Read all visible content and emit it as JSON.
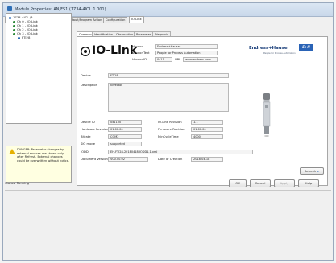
{
  "window": {
    "title": "Module Properties: AN/FS1 (1734-4IOL 1.001)"
  },
  "tabs": [
    {
      "label": "General",
      "active": false
    },
    {
      "label": "Connection",
      "active": false
    },
    {
      "label": "Module Info",
      "active": false
    },
    {
      "label": "Fault/Program Action",
      "active": false
    },
    {
      "label": "Configuration",
      "active": false
    },
    {
      "label": "IO-Link",
      "active": true
    }
  ],
  "tree": {
    "items": [
      {
        "label": "1734-4IOL /A",
        "level": 0
      },
      {
        "label": "Ch 0 - IO-Link",
        "level": 1
      },
      {
        "label": "Ch 1 - IO-Link",
        "level": 1
      },
      {
        "label": "Ch 2 - IO-Link",
        "level": 1
      },
      {
        "label": "Ch 3 - IO-Link",
        "level": 1
      },
      {
        "label": "FTI28",
        "level": 2
      }
    ]
  },
  "warning": {
    "text": "DANGER: Parameter changes by external sources are shown only after Refresh. External changes could be overwritten without notice."
  },
  "subtabs": [
    {
      "label": "Common",
      "active": true
    },
    {
      "label": "Identification",
      "active": false
    },
    {
      "label": "Observation",
      "active": false
    },
    {
      "label": "Parameter",
      "active": false
    },
    {
      "label": "Diagnosis",
      "active": false
    }
  ],
  "brand": {
    "iolink_text": "IO-Link",
    "vendor_logo_text": "Endress+Hauser",
    "vendor_logo_badge": "E+H",
    "vendor_tagline": "People for Process Automation",
    "accent": "#2a63b6"
  },
  "vendor": {
    "vendor_label": "Vendor",
    "vendor_value": "Endress+Hauser",
    "vendor_text_label": "Vendor Text",
    "vendor_text_value": "People for Process Automation",
    "vendor_id_label": "Vendor ID",
    "vendor_id_value": "0x11",
    "url_label": "URL",
    "url_value": "www.endress.com"
  },
  "device": {
    "device_label": "Device",
    "device_value": "FTI28",
    "description_label": "Description",
    "description_value": "Nivector"
  },
  "details": {
    "device_id_label": "Device ID",
    "device_id_value": "0x1100",
    "hw_rev_label": "Hardware Revision",
    "hw_rev_value": "01.00.00",
    "bitrate_label": "Bitrate",
    "bitrate_value": "COM2",
    "sio_label": "SIO mode",
    "sio_value": "supported",
    "iolink_rev_label": "IO-Link Revision",
    "iolink_rev_value": "1.1",
    "fw_rev_label": "Firmware Revision",
    "fw_rev_value": "01.00.00",
    "mincycle_label": "MinCycleTime",
    "mincycle_value": "4000",
    "iodd_label": "IODD",
    "iodd_value": "EH-FTI28-20180418-IODD1.1.xml",
    "doc_version_label": "Document Version",
    "doc_version_value": "V00.00.02",
    "doc_date_label": "Date of Creation",
    "doc_date_value": "2018-04-18"
  },
  "buttons": {
    "refresh": "Refresh",
    "ok": "OK",
    "cancel": "Cancel",
    "apply": "Apply",
    "help": "Help"
  },
  "status": {
    "text": "Status:  Running"
  }
}
